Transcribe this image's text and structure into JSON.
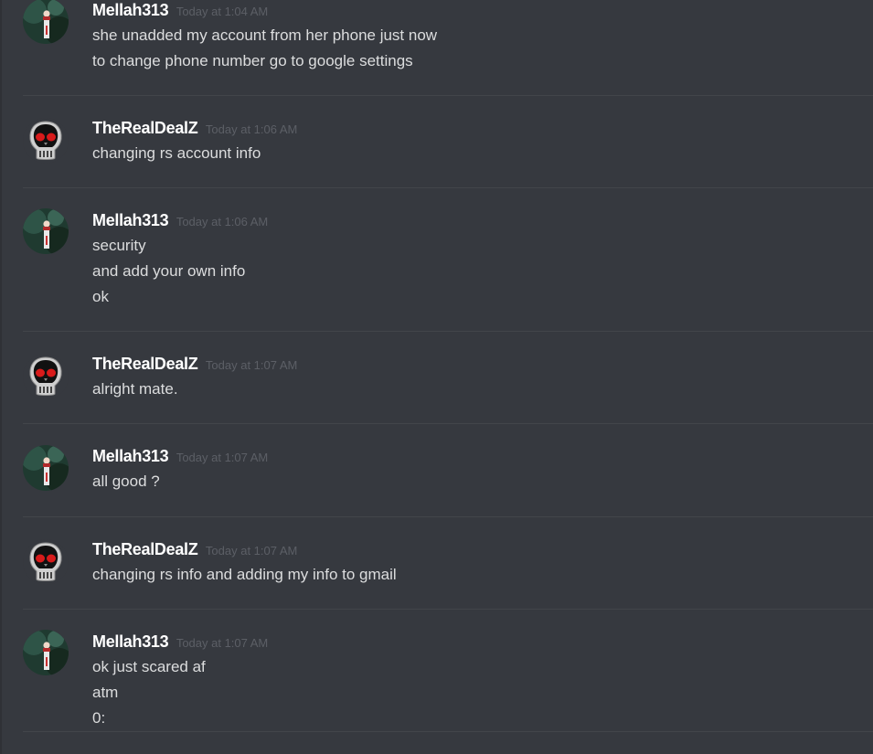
{
  "colors": {
    "background": "#36393f",
    "username": "#ffffff",
    "message_text": "#dcddde",
    "timestamp": "#5c5f66",
    "divider": "#42454a"
  },
  "messages": [
    {
      "username": "Mellah313",
      "timestamp": "Today at 1:04 AM",
      "avatar_icon": "woman-in-forest-avatar",
      "lines": [
        "she unadded my account from her phone just now",
        "to change phone number go to google settings"
      ]
    },
    {
      "username": "TheRealDealZ",
      "timestamp": "Today at 1:06 AM",
      "avatar_icon": "skull-avatar",
      "lines": [
        "changing rs account info"
      ]
    },
    {
      "username": "Mellah313",
      "timestamp": "Today at 1:06 AM",
      "avatar_icon": "woman-in-forest-avatar",
      "lines": [
        "security",
        "and add your own info",
        "ok"
      ]
    },
    {
      "username": "TheRealDealZ",
      "timestamp": "Today at 1:07 AM",
      "avatar_icon": "skull-avatar",
      "lines": [
        "alright mate."
      ]
    },
    {
      "username": "Mellah313",
      "timestamp": "Today at 1:07 AM",
      "avatar_icon": "woman-in-forest-avatar",
      "lines": [
        "all good ?"
      ]
    },
    {
      "username": "TheRealDealZ",
      "timestamp": "Today at 1:07 AM",
      "avatar_icon": "skull-avatar",
      "lines": [
        "changing rs info and adding my info to gmail"
      ]
    },
    {
      "username": "Mellah313",
      "timestamp": "Today at 1:07 AM",
      "avatar_icon": "woman-in-forest-avatar",
      "lines": [
        "ok just scared af",
        "atm",
        "0:"
      ]
    }
  ]
}
